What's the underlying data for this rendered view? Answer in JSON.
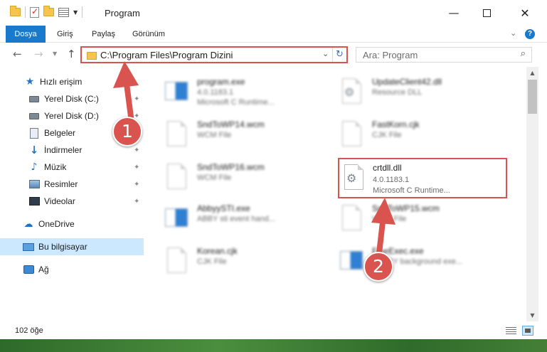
{
  "window": {
    "title": "Program"
  },
  "ribbon": {
    "tabs": [
      "Dosya",
      "Giriş",
      "Paylaş",
      "Görünüm"
    ]
  },
  "address": {
    "path": "C:\\Program Files\\Program Dizini"
  },
  "search": {
    "placeholder": "Ara: Program"
  },
  "sidebar": {
    "items": [
      {
        "label": "Hızlı erişim",
        "icon": "star-icon"
      },
      {
        "label": "Yerel Disk (C:)",
        "icon": "disk-icon",
        "pinned": true
      },
      {
        "label": "Yerel Disk (D:)",
        "icon": "disk-icon",
        "pinned": true
      },
      {
        "label": "Belgeler",
        "icon": "documents-icon",
        "pinned": true
      },
      {
        "label": "İndirmeler",
        "icon": "download-icon",
        "pinned": true
      },
      {
        "label": "Müzik",
        "icon": "music-icon",
        "pinned": true
      },
      {
        "label": "Resimler",
        "icon": "pictures-icon",
        "pinned": true
      },
      {
        "label": "Videolar",
        "icon": "videos-icon",
        "pinned": true
      },
      {
        "label": "OneDrive",
        "icon": "cloud-icon"
      },
      {
        "label": "Bu bilgisayar",
        "icon": "computer-icon",
        "selected": true
      },
      {
        "label": "Ağ",
        "icon": "network-icon"
      }
    ]
  },
  "files": [
    {
      "name": "program.exe",
      "line1": "4.0.1183.1",
      "line2": "Microsoft C Runtime...",
      "icon": "app-icon"
    },
    {
      "name": "UpdateClient42.dll",
      "line1": "Resource DLL",
      "line2": "",
      "icon": "gear-file-icon"
    },
    {
      "name": "SndToWP14.wcm",
      "line1": "WCM File",
      "line2": "",
      "icon": "file-icon"
    },
    {
      "name": "FastKorn.cjk",
      "line1": "CJK File",
      "line2": "",
      "icon": "file-icon"
    },
    {
      "name": "SndToWP16.wcm",
      "line1": "WCM File",
      "line2": "",
      "icon": "file-icon"
    },
    {
      "name": "AbbyySTI.exe",
      "line1": "ABBY sti event hand...",
      "line2": "",
      "icon": "app-icon"
    },
    {
      "name": "SndToWP15.wcm",
      "line1": "WCM File",
      "line2": "",
      "icon": "file-icon"
    },
    {
      "name": "Korean.cjk",
      "line1": "CJK File",
      "line2": "",
      "icon": "file-icon"
    },
    {
      "name": "FineExec.exe",
      "line1": "ABBYY background exe...",
      "line2": "",
      "icon": "app-icon"
    }
  ],
  "highlighted_file": {
    "name": "crtdll.dll",
    "version": "4.0.1183.1",
    "description": "Microsoft C Runtime..."
  },
  "status": {
    "count": "102 öğe"
  },
  "annotations": {
    "step1": "1",
    "step2": "2",
    "color": "#d9534f"
  },
  "colors": {
    "accent": "#1979ca",
    "selection": "#cce8ff"
  }
}
